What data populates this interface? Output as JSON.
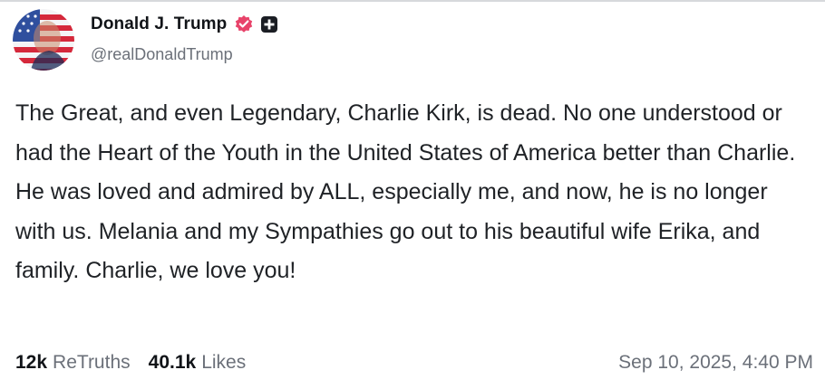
{
  "author": {
    "display_name": "Donald J. Trump",
    "handle": "@realDonaldTrump",
    "avatar_icon": "avatar-flag-portrait",
    "badges": [
      "verified-icon",
      "plus-badge-icon"
    ],
    "verified_color": "#e8436a"
  },
  "post": {
    "text": "The Great, and even Legendary, Charlie Kirk, is dead. No one understood or had the Heart of the Youth in the United States of America better than Charlie. He was loved and admired by ALL, especially me, and now, he is no longer with us. Melania and my Sympathies go out to his beautiful wife Erika, and family. Charlie, we love you!"
  },
  "stats": {
    "retruths_count": "12k",
    "retruths_label": "ReTruths",
    "likes_count": "40.1k",
    "likes_label": "Likes"
  },
  "timestamp": "Sep 10, 2025, 4:40 PM"
}
